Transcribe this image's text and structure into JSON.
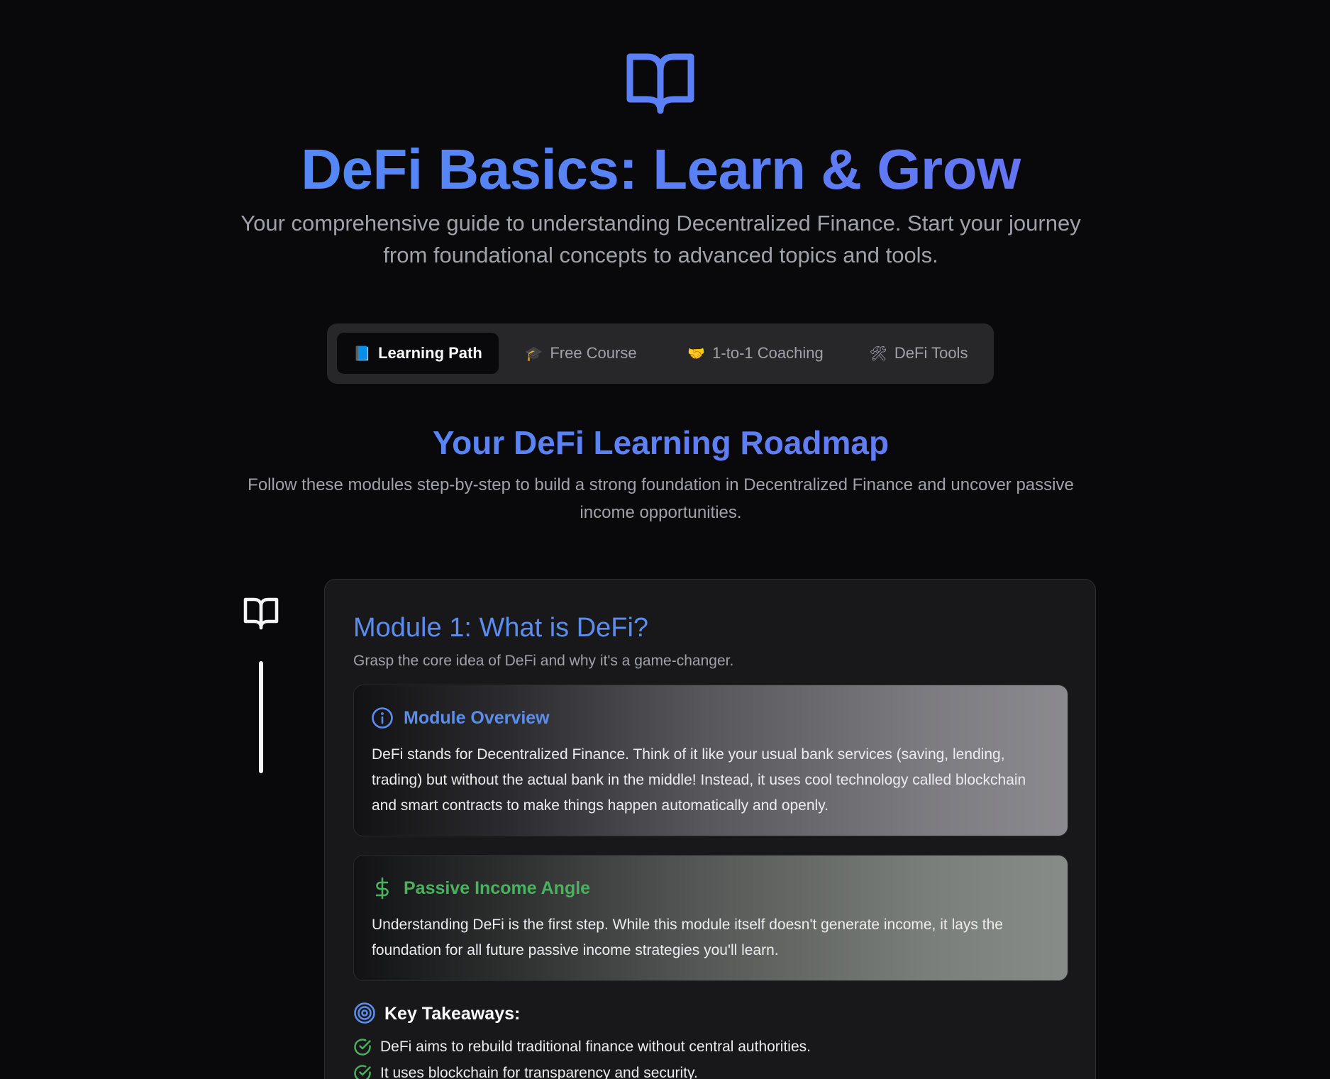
{
  "hero": {
    "icon": "book-open-icon",
    "title": "DeFi Basics: Learn & Grow",
    "subtitle": "Your comprehensive guide to understanding Decentralized Finance. Start your journey from foundational concepts to advanced topics and tools."
  },
  "tabs": [
    {
      "emoji": "📘",
      "label": "Learning Path",
      "active": true
    },
    {
      "emoji": "🎓",
      "label": "Free Course",
      "active": false
    },
    {
      "emoji": "🤝",
      "label": "1-to-1 Coaching",
      "active": false
    },
    {
      "emoji": "🛠",
      "label": "DeFi Tools",
      "active": false
    }
  ],
  "roadmap": {
    "title": "Your DeFi Learning Roadmap",
    "subtitle": "Follow these modules step-by-step to build a strong foundation in Decentralized Finance and uncover passive income opportunities."
  },
  "module": {
    "icon": "book-open-icon",
    "title": "Module 1: What is DeFi?",
    "subtitle": "Grasp the core idea of DeFi and why it's a game-changer.",
    "overview": {
      "icon": "info-icon",
      "heading": "Module Overview",
      "text": "DeFi stands for Decentralized Finance. Think of it like your usual bank services (saving, lending, trading) but without the actual bank in the middle! Instead, it uses cool technology called blockchain and smart contracts to make things happen automatically and openly."
    },
    "income": {
      "icon": "dollar-icon",
      "heading": "Passive Income Angle",
      "text": "Understanding DeFi is the first step. While this module itself doesn't generate income, it lays the foundation for all future passive income strategies you'll learn."
    },
    "takeaways": {
      "icon": "target-icon",
      "heading": "Key Takeaways:",
      "items": [
        "DeFi aims to rebuild traditional finance without central authorities.",
        "It uses blockchain for transparency and security."
      ]
    }
  },
  "colors": {
    "background": "#09090b",
    "accent_blue": "#5b8def",
    "accent_green": "#4ab25e",
    "card": "#18181b"
  }
}
